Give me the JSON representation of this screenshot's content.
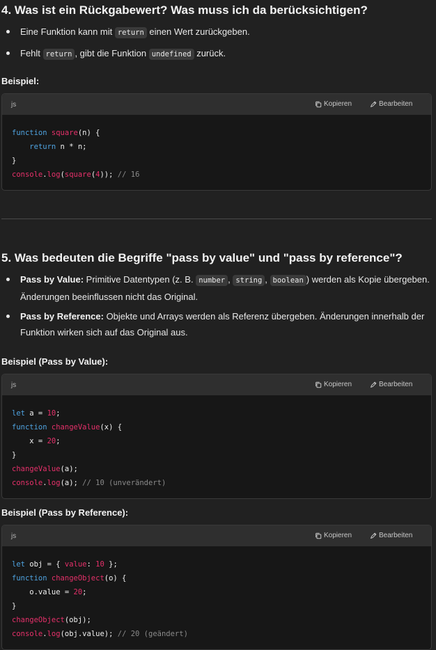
{
  "section4": {
    "heading": "4. Was ist ein Rückgabewert? Was muss ich da berücksichtigen?",
    "bullet1": {
      "pre": "Eine Funktion kann mit ",
      "code": "return",
      "post": " einen Wert zurückgeben."
    },
    "bullet2": {
      "pre": "Fehlt ",
      "code1": "return",
      "mid": ", gibt die Funktion ",
      "code2": "undefined",
      "post": " zurück."
    },
    "example_label": "Beispiel:"
  },
  "section5": {
    "heading": "5. Was bedeuten die Begriffe \"pass by value\" und \"pass by reference\"?",
    "bullet1": {
      "bold": "Pass by Value:",
      "pre": " Primitive Datentypen (z. B. ",
      "code1": "number",
      "sep1": ", ",
      "code2": "string",
      "sep2": ", ",
      "code3": "boolean",
      "post": ") werden als Kopie übergeben. Änderungen beeinflussen nicht das Original."
    },
    "bullet2": {
      "bold": "Pass by Reference:",
      "text": " Objekte und Arrays werden als Referenz übergeben. Änderungen innerhalb der Funktion wirken sich auf das Original aus."
    },
    "example_value_label": "Beispiel (Pass by Value):",
    "example_reference_label": "Beispiel (Pass by Reference):"
  },
  "codeblock_ui": {
    "lang": "js",
    "copy_label": "Kopieren",
    "edit_label": "Bearbeiten",
    "copy_icon": "copy-icon",
    "edit_icon": "pencil-icon"
  },
  "code_blocks": [
    {
      "lines": [
        [
          [
            "kw",
            "function"
          ],
          [
            "t",
            " "
          ],
          [
            "fn",
            "square"
          ],
          [
            "t",
            "(n) {"
          ]
        ],
        [
          [
            "t",
            "    "
          ],
          [
            "kw",
            "return"
          ],
          [
            "t",
            " n * n;"
          ]
        ],
        [
          [
            "t",
            "}"
          ]
        ],
        [
          [
            "fn",
            "console"
          ],
          [
            "t",
            "."
          ],
          [
            "fn",
            "log"
          ],
          [
            "t",
            "("
          ],
          [
            "fn",
            "square"
          ],
          [
            "t",
            "("
          ],
          [
            "num",
            "4"
          ],
          [
            "t",
            "));"
          ],
          [
            "t",
            " "
          ],
          [
            "cm",
            "// 16"
          ]
        ]
      ]
    },
    {
      "lines": [
        [
          [
            "kw",
            "let"
          ],
          [
            "t",
            " a = "
          ],
          [
            "num",
            "10"
          ],
          [
            "t",
            ";"
          ]
        ],
        [
          [
            "kw",
            "function"
          ],
          [
            "t",
            " "
          ],
          [
            "fn",
            "changeValue"
          ],
          [
            "t",
            "(x) {"
          ]
        ],
        [
          [
            "t",
            "    x = "
          ],
          [
            "num",
            "20"
          ],
          [
            "t",
            ";"
          ]
        ],
        [
          [
            "t",
            "}"
          ]
        ],
        [
          [
            "fn",
            "changeValue"
          ],
          [
            "t",
            "(a);"
          ]
        ],
        [
          [
            "fn",
            "console"
          ],
          [
            "t",
            "."
          ],
          [
            "fn",
            "log"
          ],
          [
            "t",
            "(a); "
          ],
          [
            "cm",
            "// 10 (unverändert)"
          ]
        ]
      ]
    },
    {
      "lines": [
        [
          [
            "kw",
            "let"
          ],
          [
            "t",
            " obj = { "
          ],
          [
            "fn",
            "value"
          ],
          [
            "t",
            ": "
          ],
          [
            "num",
            "10"
          ],
          [
            "t",
            " };"
          ]
        ],
        [
          [
            "kw",
            "function"
          ],
          [
            "t",
            " "
          ],
          [
            "fn",
            "changeObject"
          ],
          [
            "t",
            "(o) {"
          ]
        ],
        [
          [
            "t",
            "    o.value = "
          ],
          [
            "num",
            "20"
          ],
          [
            "t",
            ";"
          ]
        ],
        [
          [
            "t",
            "}"
          ]
        ],
        [
          [
            "fn",
            "changeObject"
          ],
          [
            "t",
            "(obj);"
          ]
        ],
        [
          [
            "fn",
            "console"
          ],
          [
            "t",
            "."
          ],
          [
            "fn",
            "log"
          ],
          [
            "t",
            "(obj.value); "
          ],
          [
            "cm",
            "// 20 (geändert)"
          ]
        ]
      ]
    }
  ]
}
